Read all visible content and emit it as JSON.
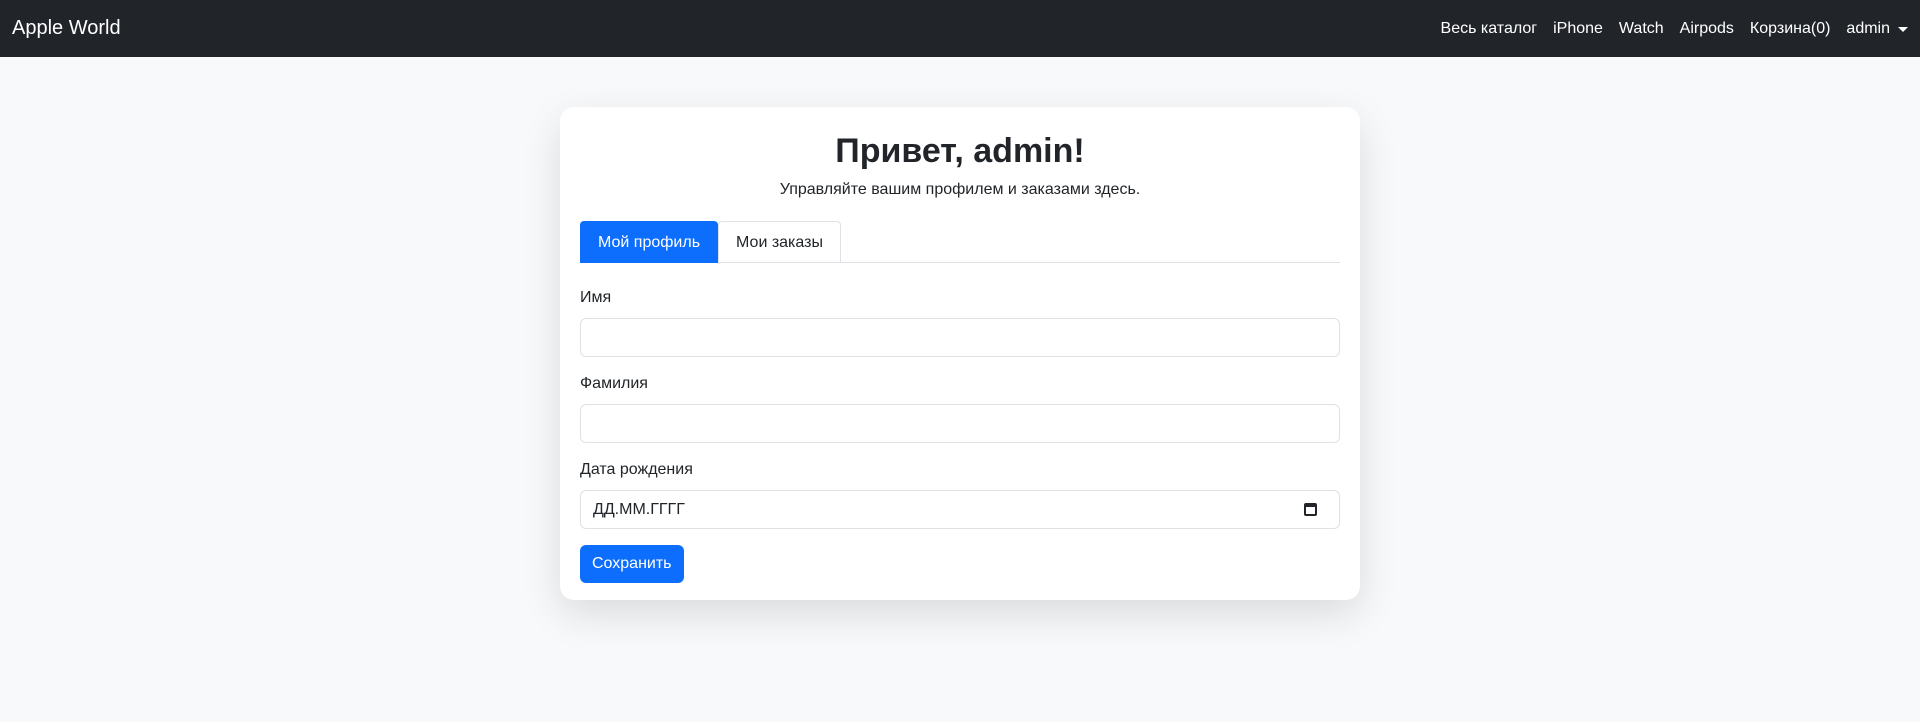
{
  "navbar": {
    "brand": "Apple World",
    "links": {
      "catalog": "Весь каталог",
      "iphone": "iPhone",
      "watch": "Watch",
      "airpods": "Airpods",
      "cart": "Корзина(0)",
      "user": "admin"
    }
  },
  "profile": {
    "title": "Привет, admin!",
    "subtitle": "Управляйте вашим профилем и заказами здесь.",
    "tabs": {
      "profile": "Мой профиль",
      "orders": "Мои заказы"
    },
    "fields": {
      "first_name_label": "Имя",
      "first_name_value": "",
      "last_name_label": "Фамилия",
      "last_name_value": "",
      "birth_date_label": "Дата рождения",
      "birth_date_placeholder": "ДД.ММ.ГГГГ"
    },
    "save_label": "Сохранить"
  },
  "colors": {
    "navbar_bg": "#212529",
    "primary": "#0d6efd",
    "page_bg": "#f8f9fa"
  }
}
